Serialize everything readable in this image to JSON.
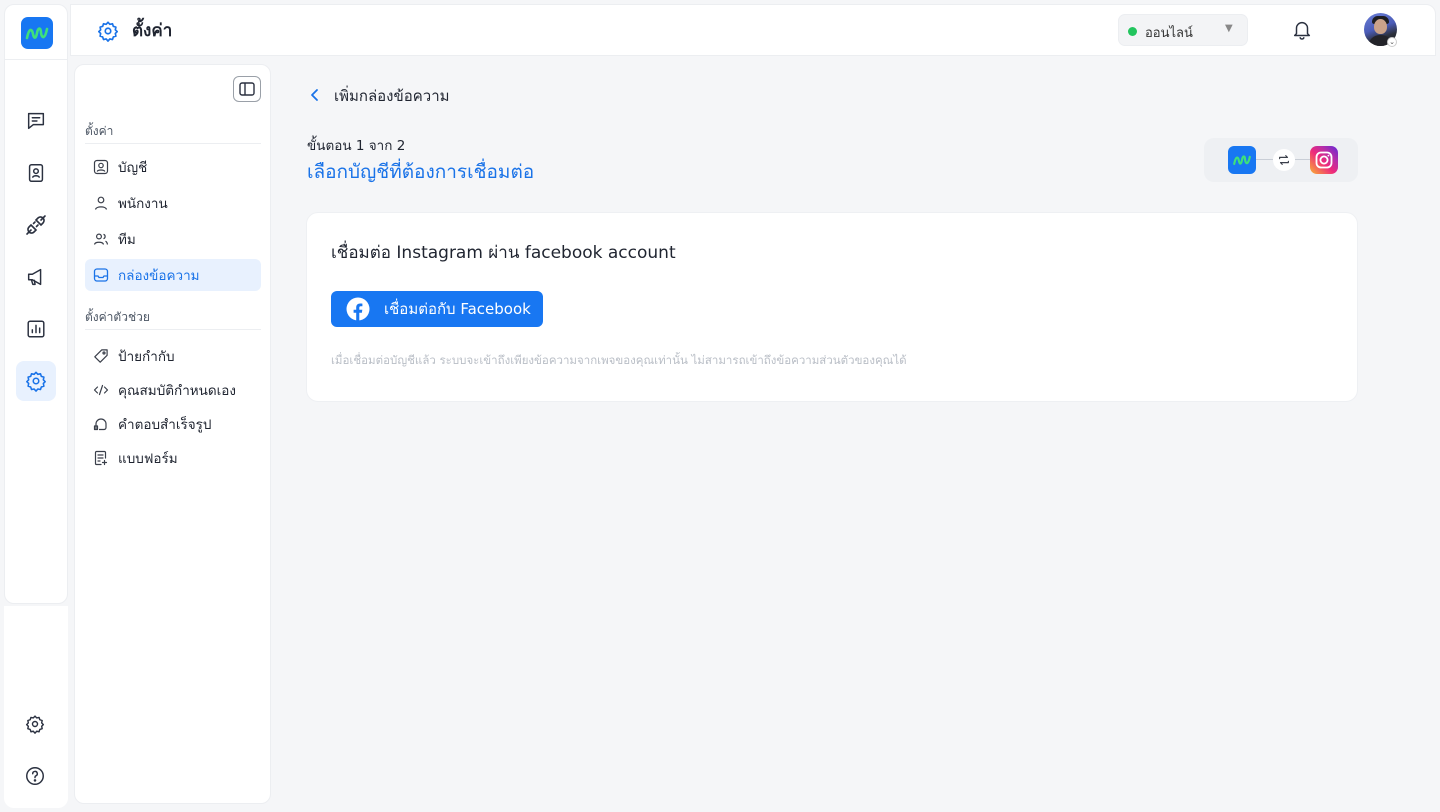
{
  "app": {
    "brand_color": "#1877f2",
    "accent_color": "#1a73e8"
  },
  "rail": {
    "items": [
      {
        "icon": "chat-icon"
      },
      {
        "icon": "contacts-icon"
      },
      {
        "icon": "plug-icon"
      },
      {
        "icon": "megaphone-icon"
      },
      {
        "icon": "chart-icon"
      },
      {
        "icon": "gear-icon",
        "active": true
      }
    ],
    "bottom": [
      {
        "icon": "gear-icon"
      },
      {
        "icon": "help-icon"
      }
    ]
  },
  "header": {
    "title": "ตั้งค่า",
    "status": {
      "label": "ออนไลน์",
      "color": "#22c55e"
    }
  },
  "sidebar": {
    "section1": {
      "title": "ตั้งค่า",
      "items": [
        {
          "label": "บัญชี",
          "icon": "user-card-icon"
        },
        {
          "label": "พนักงาน",
          "icon": "user-icon"
        },
        {
          "label": "ทีม",
          "icon": "users-icon"
        },
        {
          "label": "กล่องข้อความ",
          "icon": "inbox-icon",
          "active": true
        }
      ]
    },
    "section2": {
      "title": "ตั้งค่าตัวช่วย",
      "items": [
        {
          "label": "ป้ายกำกับ",
          "icon": "tag-icon"
        },
        {
          "label": "คุณสมบัติกำหนดเอง",
          "icon": "code-icon"
        },
        {
          "label": "คำตอบสำเร็จรูป",
          "icon": "quick-reply-icon"
        },
        {
          "label": "แบบฟอร์ม",
          "icon": "form-icon"
        }
      ]
    }
  },
  "main": {
    "breadcrumb": "เพิ่มกล่องข้อความ",
    "step": "ขั้นตอน 1 จาก 2",
    "heading": "เลือกบัญชีที่ต้องการเชื่อมต่อ",
    "card": {
      "title": "เชื่อมต่อ Instagram ผ่าน facebook account",
      "button_label": "เชื่อมต่อกับ Facebook",
      "hint": "เมื่อเชื่อมต่อบัญชีแล้ว ระบบจะเข้าถึงเพียงข้อความจากเพจของคุณเท่านั้น ไม่สามารถเข้าถึงข้อความส่วนตัวของคุณได้"
    }
  }
}
